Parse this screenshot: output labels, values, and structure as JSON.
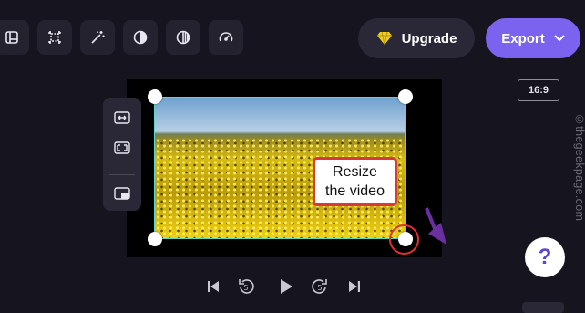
{
  "toolbar": {
    "tools": [
      {
        "icon": "layout-icon"
      },
      {
        "icon": "crop-icon"
      },
      {
        "icon": "magic-wand-icon"
      },
      {
        "icon": "contrast-icon"
      },
      {
        "icon": "color-filter-icon"
      },
      {
        "icon": "speed-icon"
      }
    ]
  },
  "header": {
    "upgrade_label": "Upgrade",
    "upgrade_icon": "diamond-icon",
    "export_label": "Export",
    "export_icon": "chevron-down-icon"
  },
  "canvas": {
    "aspect_ratio": "16:9",
    "side_tools": [
      "fit-icon",
      "fill-icon",
      "picture-in-picture-icon"
    ]
  },
  "annotation": {
    "callout_line1": "Resize",
    "callout_line2": "the video"
  },
  "playback": {
    "buttons": [
      "skip-back-icon",
      "rewind-5-icon",
      "play-icon",
      "forward-5-icon",
      "skip-forward-icon"
    ],
    "rewind_seconds": "5",
    "forward_seconds": "5"
  },
  "help": {
    "label": "?"
  },
  "watermark": "©thegeekpage.com",
  "colors": {
    "background": "#15141f",
    "accent": "#7b63f0",
    "selection_border": "#5fd7c8",
    "annotation_red": "#d83a35",
    "annotation_purple": "#6b2fa0",
    "upgrade_diamond": "#f2cf1e"
  }
}
